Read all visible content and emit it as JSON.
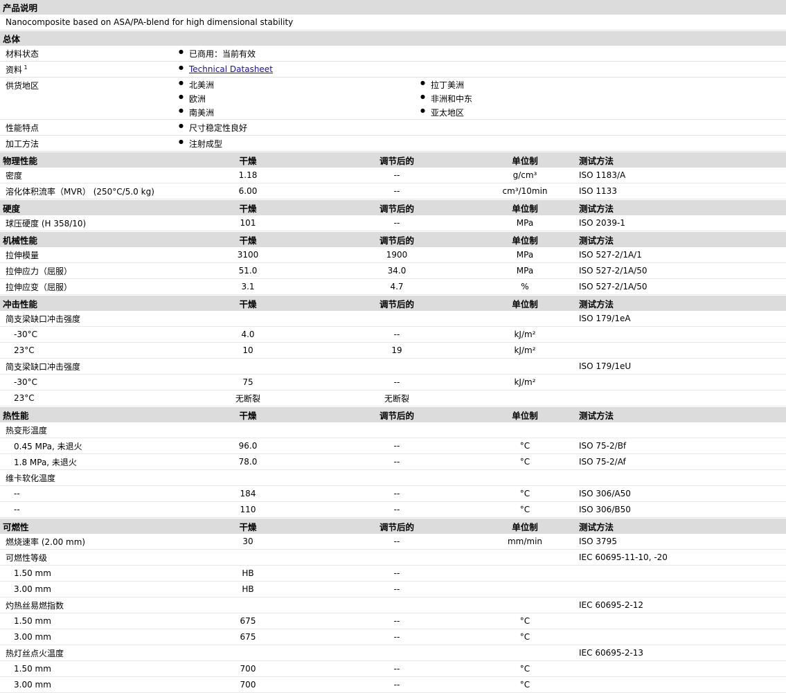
{
  "product_description": {
    "header": "产品说明",
    "text": "Nanocomposite based on ASA/PA-blend for high dimensional stability"
  },
  "general": {
    "header": "总体",
    "rows": [
      {
        "label": "材料状态",
        "values": [
          "已商用：当前有效"
        ]
      },
      {
        "label": "资料",
        "sup": "1",
        "values": [
          "Technical Datasheet"
        ],
        "link": true
      },
      {
        "label": "供货地区",
        "values": [
          "北美洲",
          "拉丁美洲",
          "欧洲",
          "非洲和中东",
          "南美洲",
          "亚太地区"
        ]
      },
      {
        "label": "性能特点",
        "values": [
          "尺寸稳定性良好"
        ]
      },
      {
        "label": "加工方法",
        "values": [
          "注射成型"
        ]
      }
    ]
  },
  "columns": {
    "dry": "干燥",
    "conditioned": "调节后的",
    "unit": "单位制",
    "method": "测试方法"
  },
  "sections": [
    {
      "name": "物理性能",
      "rows": [
        {
          "prop": "密度",
          "dry": "1.18",
          "cond": "--",
          "unit": "g/cm³",
          "method": "ISO 1183/A"
        },
        {
          "prop": "溶化体积流率（MVR） (250°C/5.0 kg)",
          "dry": "6.00",
          "cond": "--",
          "unit": "cm³/10min",
          "method": "ISO 1133"
        }
      ]
    },
    {
      "name": "硬度",
      "rows": [
        {
          "prop": "球压硬度 (H 358/10)",
          "dry": "101",
          "cond": "--",
          "unit": "MPa",
          "method": "ISO 2039-1"
        }
      ]
    },
    {
      "name": "机械性能",
      "rows": [
        {
          "prop": "拉伸模量",
          "dry": "3100",
          "cond": "1900",
          "unit": "MPa",
          "method": "ISO 527-2/1A/1"
        },
        {
          "prop": "拉伸应力（屈服）",
          "dry": "51.0",
          "cond": "34.0",
          "unit": "MPa",
          "method": "ISO 527-2/1A/50"
        },
        {
          "prop": "拉伸应变（屈服）",
          "dry": "3.1",
          "cond": "4.7",
          "unit": "%",
          "method": "ISO 527-2/1A/50"
        }
      ]
    },
    {
      "name": "冲击性能",
      "rows": [
        {
          "prop": "简支梁缺口冲击强度",
          "dry": "",
          "cond": "",
          "unit": "",
          "method": "ISO 179/1eA"
        },
        {
          "prop": "-30°C",
          "indent": true,
          "dry": "4.0",
          "cond": "--",
          "unit": "kJ/m²",
          "method": ""
        },
        {
          "prop": "23°C",
          "indent": true,
          "dry": "10",
          "cond": "19",
          "unit": "kJ/m²",
          "method": ""
        },
        {
          "prop": "简支梁缺口冲击强度",
          "dry": "",
          "cond": "",
          "unit": "",
          "method": "ISO 179/1eU"
        },
        {
          "prop": "-30°C",
          "indent": true,
          "dry": "75",
          "cond": "--",
          "unit": "kJ/m²",
          "method": ""
        },
        {
          "prop": "23°C",
          "indent": true,
          "dry": "无断裂",
          "cond": "无断裂",
          "unit": "",
          "method": ""
        }
      ]
    },
    {
      "name": "热性能",
      "rows": [
        {
          "prop": "热变形温度",
          "dry": "",
          "cond": "",
          "unit": "",
          "method": ""
        },
        {
          "prop": "0.45 MPa, 未退火",
          "indent": true,
          "dry": "96.0",
          "cond": "--",
          "unit": "°C",
          "method": "ISO 75-2/Bf"
        },
        {
          "prop": "1.8 MPa, 未退火",
          "indent": true,
          "dry": "78.0",
          "cond": "--",
          "unit": "°C",
          "method": "ISO 75-2/Af"
        },
        {
          "prop": "维卡软化温度",
          "dry": "",
          "cond": "",
          "unit": "",
          "method": ""
        },
        {
          "prop": "--",
          "indent": true,
          "dry": "184",
          "cond": "--",
          "unit": "°C",
          "method": "ISO 306/A50"
        },
        {
          "prop": "--",
          "indent": true,
          "dry": "110",
          "cond": "--",
          "unit": "°C",
          "method": "ISO 306/B50"
        }
      ]
    },
    {
      "name": "可燃性",
      "rows": [
        {
          "prop": "燃烧速率 (2.00 mm)",
          "dry": "30",
          "cond": "--",
          "unit": "mm/min",
          "method": "ISO 3795"
        },
        {
          "prop": "可燃性等级",
          "dry": "",
          "cond": "",
          "unit": "",
          "method": "IEC 60695-11-10, -20"
        },
        {
          "prop": "1.50 mm",
          "indent": true,
          "dry": "HB",
          "cond": "--",
          "unit": "",
          "method": ""
        },
        {
          "prop": "3.00 mm",
          "indent": true,
          "dry": "HB",
          "cond": "--",
          "unit": "",
          "method": ""
        },
        {
          "prop": "灼热丝易燃指数",
          "dry": "",
          "cond": "",
          "unit": "",
          "method": "IEC 60695-2-12"
        },
        {
          "prop": "1.50 mm",
          "indent": true,
          "dry": "675",
          "cond": "--",
          "unit": "°C",
          "method": ""
        },
        {
          "prop": "3.00 mm",
          "indent": true,
          "dry": "675",
          "cond": "--",
          "unit": "°C",
          "method": ""
        },
        {
          "prop": "热灯丝点火温度",
          "dry": "",
          "cond": "",
          "unit": "",
          "method": "IEC 60695-2-13"
        },
        {
          "prop": "1.50 mm",
          "indent": true,
          "dry": "700",
          "cond": "--",
          "unit": "°C",
          "method": ""
        },
        {
          "prop": "3.00 mm",
          "indent": true,
          "dry": "700",
          "cond": "--",
          "unit": "°C",
          "method": ""
        }
      ]
    }
  ]
}
